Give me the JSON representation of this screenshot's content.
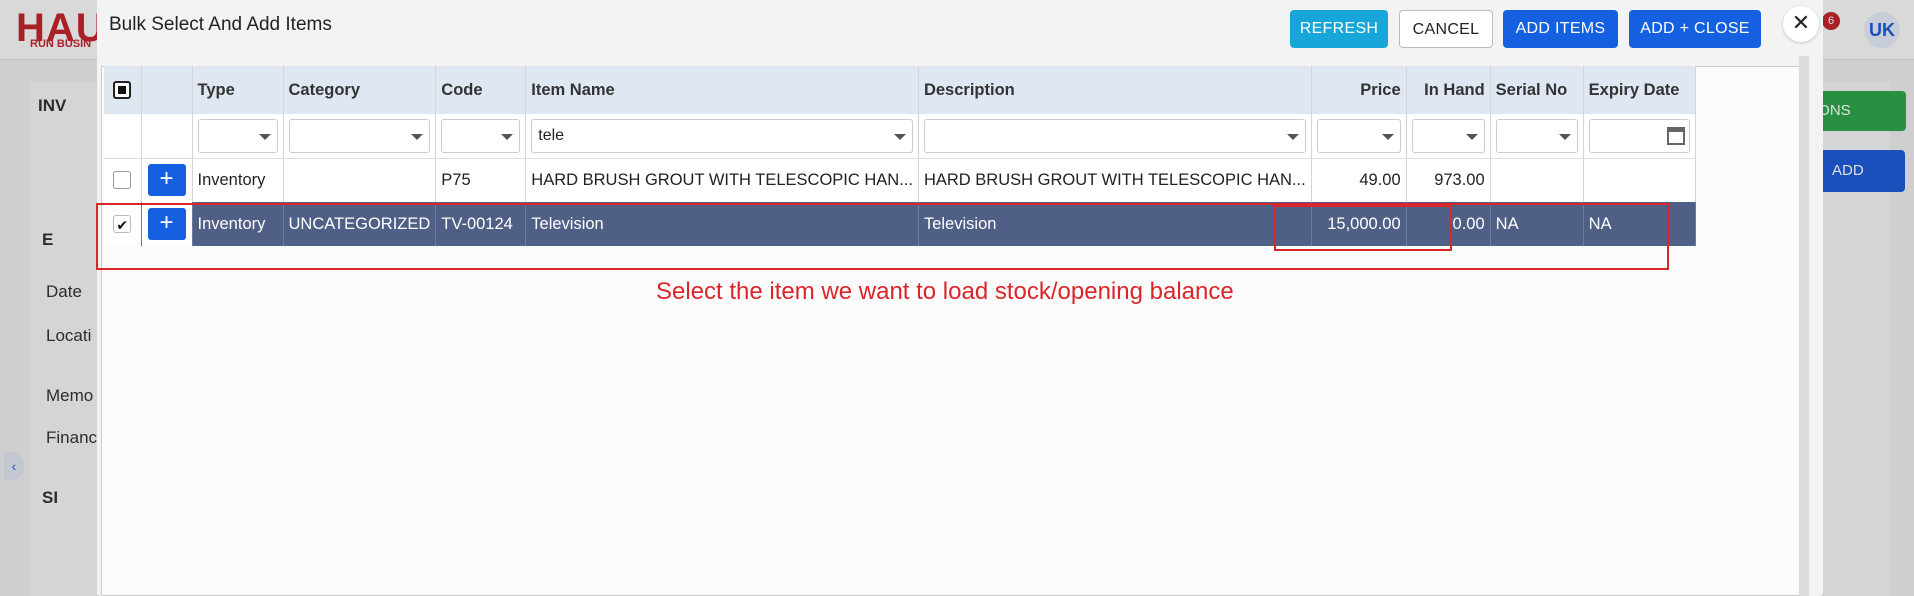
{
  "background": {
    "logo": "HAU",
    "logo_sub": "RUN BUSIN",
    "heading": "INV",
    "section1": "E",
    "labels": [
      "Date",
      "Locati",
      "Memo",
      "Financ"
    ],
    "section2": "SI",
    "green_button": "IONS",
    "blue_button": "ADD",
    "avatar": "UK",
    "badge": "6"
  },
  "modal": {
    "title": "Bulk Select And Add Items",
    "buttons": {
      "refresh": "REFRESH",
      "cancel": "CANCEL",
      "add_items": "ADD ITEMS",
      "add_close": "ADD + CLOSE",
      "close": "✕"
    }
  },
  "grid": {
    "columns": [
      "Type",
      "Category",
      "Code",
      "Item Name",
      "Description",
      "Price",
      "In Hand",
      "Serial No",
      "Expiry Date"
    ],
    "filters": {
      "item_name": "tele"
    },
    "rows": [
      {
        "selected": false,
        "type": "Inventory",
        "category": "",
        "code": "P75",
        "item_name": "HARD BRUSH GROUT WITH TELESCOPIC HAN...",
        "description": "HARD BRUSH GROUT WITH TELESCOPIC HAN...",
        "price": "49.00",
        "in_hand": "973.00",
        "serial_no": "",
        "expiry_date": ""
      },
      {
        "selected": true,
        "type": "Inventory",
        "category": "UNCATEGORIZED",
        "code": "TV-00124",
        "item_name": "Television",
        "description": "Television",
        "price": "15,000.00",
        "in_hand": "0.00",
        "serial_no": "NA",
        "expiry_date": "NA"
      }
    ]
  },
  "annotation": "Select the item we want to load stock/opening balance",
  "colors": {
    "primary": "#1460e0",
    "refresh": "#17a6d9",
    "selected_row": "#4f5f86",
    "annotation": "#d9262b"
  }
}
